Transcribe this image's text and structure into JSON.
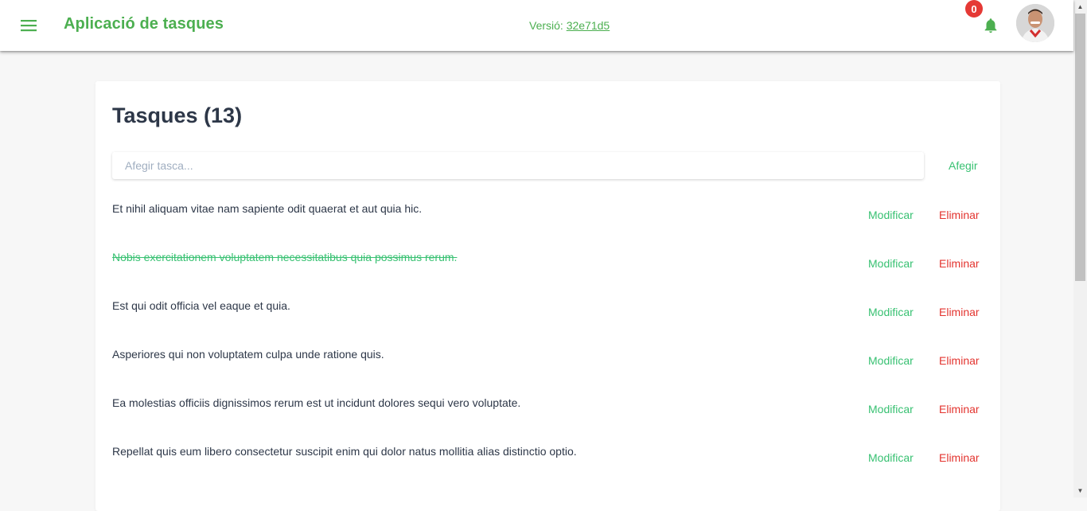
{
  "header": {
    "title": "Aplicació de tasques",
    "version_label": "Versió:",
    "version_hash": "32e71d5",
    "notification_count": "0"
  },
  "main": {
    "title": "Tasques (13)",
    "input_placeholder": "Afegir tasca...",
    "add_label": "Afegir",
    "edit_label": "Modificar",
    "delete_label": "Eliminar",
    "tasks": [
      {
        "text": "Et nihil aliquam vitae nam sapiente odit quaerat et aut quia hic.",
        "completed": false
      },
      {
        "text": "Nobis exercitationem voluptatem necessitatibus quia possimus rerum.",
        "completed": true
      },
      {
        "text": "Est qui odit officia vel eaque et quia.",
        "completed": false
      },
      {
        "text": "Asperiores qui non voluptatem culpa unde ratione quis.",
        "completed": false
      },
      {
        "text": "Ea molestias officiis dignissimos rerum est ut incidunt dolores sequi vero voluptate.",
        "completed": false
      },
      {
        "text": "Repellat quis eum libero consectetur suscipit enim qui dolor natus mollitia alias distinctio optio.",
        "completed": false
      }
    ]
  },
  "colors": {
    "brand_green": "#4caf50",
    "action_green": "#38c172",
    "danger_red": "#e3342f",
    "badge_red": "#e53935"
  },
  "icons": {
    "menu": "menu-icon",
    "notifications": "bell-icon",
    "scroll_up": "arrow-up-icon",
    "scroll_down": "arrow-down-icon"
  }
}
